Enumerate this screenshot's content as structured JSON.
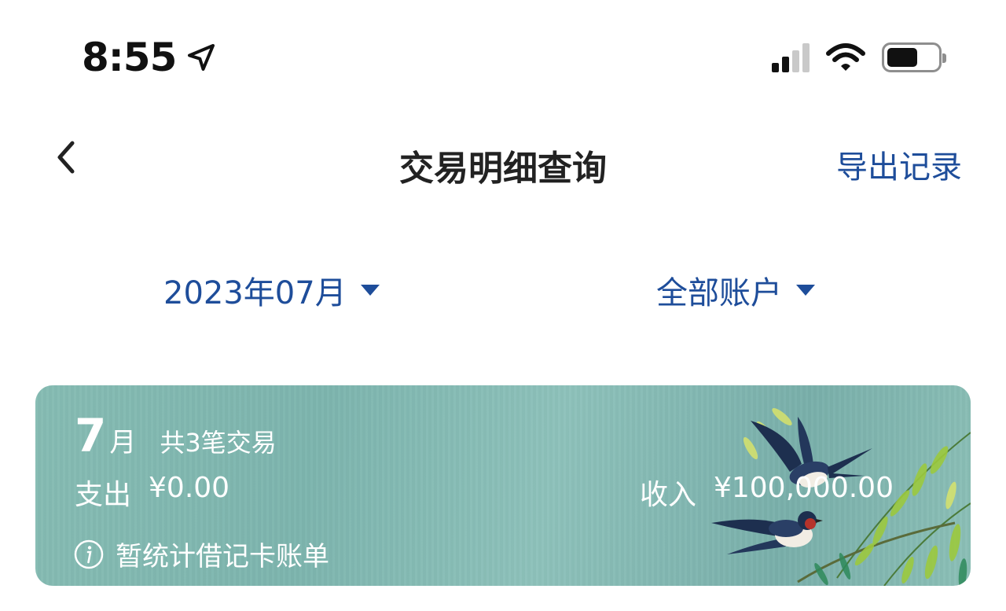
{
  "status_bar": {
    "time": "8:55",
    "location_icon": "location-arrow-icon",
    "signal_icon": "cellular-signal-icon",
    "wifi_icon": "wifi-icon",
    "battery_icon": "battery-icon"
  },
  "nav": {
    "back_icon": "chevron-left-icon",
    "title": "交易明细查询",
    "export_label": "导出记录"
  },
  "filters": {
    "month_label": "2023年07月",
    "account_label": "全部账户",
    "dropdown_icon": "caret-down-icon"
  },
  "summary": {
    "month_number": "7",
    "month_unit": "月",
    "transaction_count": "共3笔交易",
    "expense_label": "支出",
    "expense_value": "¥0.00",
    "income_label": "收入",
    "income_value": "¥100,000.00",
    "info_icon": "info-icon",
    "note": "暂统计借记卡账单",
    "decoration": "swallows-willow-illustration"
  },
  "colors": {
    "accent": "#1e4d9a",
    "card_bg": "#86bcb3",
    "text_primary": "#222222",
    "card_text": "#ffffff"
  }
}
